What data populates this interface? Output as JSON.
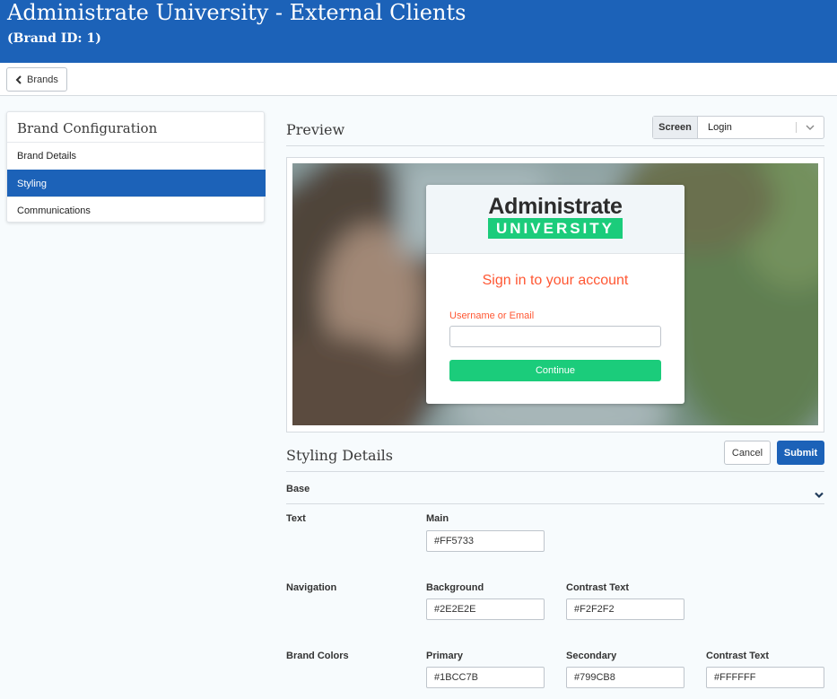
{
  "header": {
    "title": "Administrate University - External Clients",
    "subtitle": "(Brand ID: 1)",
    "bg_color": "#1c62b8"
  },
  "toolbar": {
    "back_label": "Brands"
  },
  "sidebar": {
    "title": "Brand Configuration",
    "items": [
      {
        "label": "Brand Details",
        "active": false
      },
      {
        "label": "Styling",
        "active": true
      },
      {
        "label": "Communications",
        "active": false
      }
    ]
  },
  "preview": {
    "title": "Preview",
    "screen_label": "Screen",
    "screen_value": "Login",
    "login": {
      "logo_top": "Administrate",
      "logo_badge": "UNIVERSITY",
      "heading": "Sign in to your account",
      "field_label": "Username or Email",
      "button_label": "Continue"
    }
  },
  "styling": {
    "title": "Styling Details",
    "cancel_label": "Cancel",
    "submit_label": "Submit",
    "section": "Base",
    "rows": {
      "text": {
        "label": "Text",
        "fields": [
          {
            "label": "Main",
            "value": "#FF5733"
          }
        ]
      },
      "navigation": {
        "label": "Navigation",
        "fields": [
          {
            "label": "Background",
            "value": "#2E2E2E"
          },
          {
            "label": "Contrast Text",
            "value": "#F2F2F2"
          }
        ]
      },
      "brand_colors": {
        "label": "Brand Colors",
        "fields": [
          {
            "label": "Primary",
            "value": "#1BCC7B"
          },
          {
            "label": "Secondary",
            "value": "#799CB8"
          },
          {
            "label": "Contrast Text",
            "value": "#FFFFFF"
          }
        ]
      }
    }
  }
}
